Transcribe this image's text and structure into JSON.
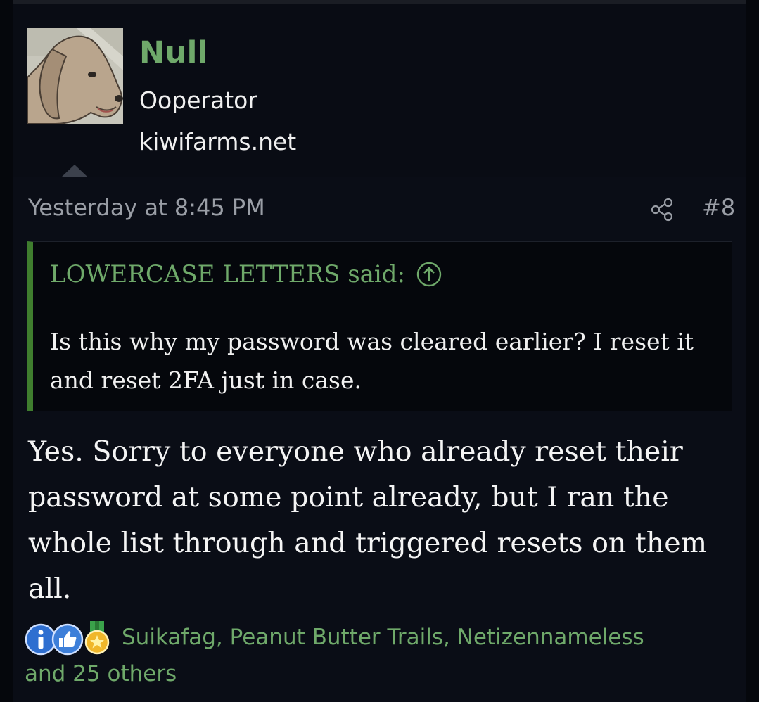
{
  "user": {
    "name": "Null",
    "title": "Ooperator",
    "site": "kiwifarms.net"
  },
  "post": {
    "timestamp": "Yesterday at 8:45 PM",
    "number": "#8",
    "quote": {
      "author_line": "LOWERCASE LETTERS said:",
      "text": "Is this why my password was cleared earlier? I reset it and reset 2FA just in case."
    },
    "body": "Yes. Sorry to everyone who already reset their password at some point already, but I ran the whole list through and triggered resets on them all."
  },
  "reactions": {
    "icons": [
      "informative-icon",
      "like-icon",
      "winner-medal-icon"
    ],
    "names": "Suikafag, Peanut Butter Trails, Netizennameless",
    "others": "and 25 others"
  },
  "colors": {
    "accent_green": "#6fa96a",
    "quote_bar": "#3f7d2e",
    "background": "#0a0d16"
  }
}
